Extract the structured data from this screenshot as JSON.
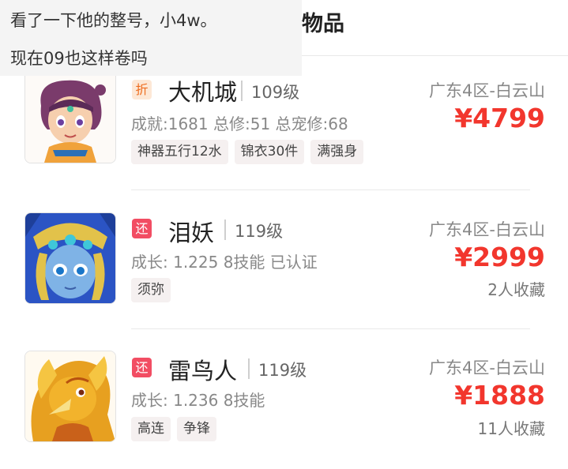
{
  "overlay": {
    "line1": "看了一下他的整号，小4w。",
    "line2": "现在09也这样卷吗"
  },
  "header": {
    "title": "物品"
  },
  "listings": [
    {
      "badge": "折",
      "name": "大机城",
      "level": "109级",
      "stats": "成就:1681 总修:51 总宠修:68",
      "tags": [
        "神器五行12水",
        "锦衣30件",
        "满强身"
      ],
      "server": "广东4区-白云山",
      "price": "¥4799",
      "favorites": ""
    },
    {
      "badge": "还",
      "name": "泪妖",
      "level": "119级",
      "stats": "成长: 1.225 8技能 已认证",
      "tags": [
        "须弥"
      ],
      "server": "广东4区-白云山",
      "price": "¥2999",
      "favorites": "2人收藏"
    },
    {
      "badge": "还",
      "name": "雷鸟人",
      "level": "119级",
      "stats": "成长: 1.236 8技能",
      "tags": [
        "高连",
        "争锋"
      ],
      "server": "广东4区-白云山",
      "price": "¥1888",
      "favorites": "11人收藏"
    }
  ],
  "colors": {
    "price": "#f2362d",
    "badge_huan": "#f24d63",
    "badge_zhe": "#ee6d1f"
  }
}
